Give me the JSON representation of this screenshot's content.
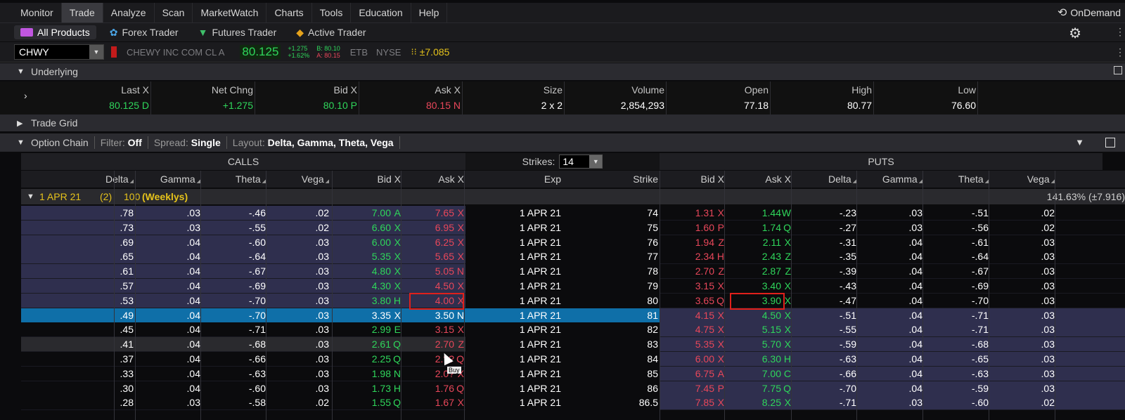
{
  "nav": {
    "tabs": [
      "Monitor",
      "Trade",
      "Analyze",
      "Scan",
      "MarketWatch",
      "Charts",
      "Tools",
      "Education",
      "Help"
    ],
    "active_tab": "Trade",
    "ondemand": "OnDemand"
  },
  "products": {
    "items": [
      "All Products",
      "Forex Trader",
      "Futures Trader",
      "Active Trader"
    ],
    "active": "All Products"
  },
  "symbol_bar": {
    "symbol": "CHWY",
    "description": "CHEWY INC COM CL A",
    "last": "80.125",
    "change_top": "+1.275",
    "change_bottom": "+1.62%",
    "bid": "B: 80.10",
    "ask": "A: 80.15",
    "etb": "ETB",
    "exchange": "NYSE",
    "expected_move": "±7.085"
  },
  "underlying": {
    "title": "Underlying",
    "headers": [
      "Last X",
      "Net Chng",
      "Bid X",
      "Ask X",
      "Size",
      "Volume",
      "Open",
      "High",
      "Low"
    ],
    "values": [
      "80.125 D",
      "+1.275",
      "80.10 P",
      "80.15 N",
      "2 x 2",
      "2,854,293",
      "77.18",
      "80.77",
      "76.60"
    ]
  },
  "trade_grid": {
    "title": "Trade Grid"
  },
  "option_chain": {
    "title": "Option Chain",
    "filter_label": "Filter:",
    "filter_value": "Off",
    "spread_label": "Spread:",
    "spread_value": "Single",
    "layout_label": "Layout:",
    "layout_value": "Delta, Gamma, Theta, Vega",
    "calls_label": "CALLS",
    "puts_label": "PUTS",
    "strikes_label": "Strikes:",
    "strikes_value": "14",
    "call_headers": [
      "Delta",
      "Gamma",
      "Theta",
      "Vega",
      "Bid X",
      "Ask X"
    ],
    "mid_headers": [
      "Exp",
      "Strike"
    ],
    "put_headers": [
      "Bid X",
      "Ask X",
      "Delta",
      "Gamma",
      "Theta",
      "Vega"
    ],
    "expiry_group": {
      "label": "1 APR 21",
      "count": "(2)",
      "mult": "100",
      "type": "(Weeklys)",
      "iv": "141.63% (±7.916)"
    },
    "rows": [
      {
        "cd": ".78",
        "cg": ".03",
        "ct": "-.46",
        "cv": ".02",
        "cb": "7.00",
        "cbx": "A",
        "ca": "7.65",
        "cax": "X",
        "exp": "1 APR 21",
        "strike": "74",
        "pb": "1.31",
        "pbx": "X",
        "pa": "1.44",
        "pax": "W",
        "pd": "-.23",
        "pg": ".03",
        "pt": "-.51",
        "pv": ".02"
      },
      {
        "cd": ".73",
        "cg": ".03",
        "ct": "-.55",
        "cv": ".02",
        "cb": "6.60",
        "cbx": "X",
        "ca": "6.95",
        "cax": "X",
        "exp": "1 APR 21",
        "strike": "75",
        "pb": "1.60",
        "pbx": "P",
        "pa": "1.74",
        "pax": "Q",
        "pd": "-.27",
        "pg": ".03",
        "pt": "-.56",
        "pv": ".02"
      },
      {
        "cd": ".69",
        "cg": ".04",
        "ct": "-.60",
        "cv": ".03",
        "cb": "6.00",
        "cbx": "X",
        "ca": "6.25",
        "cax": "X",
        "exp": "1 APR 21",
        "strike": "76",
        "pb": "1.94",
        "pbx": "Z",
        "pa": "2.11",
        "pax": "X",
        "pd": "-.31",
        "pg": ".04",
        "pt": "-.61",
        "pv": ".03"
      },
      {
        "cd": ".65",
        "cg": ".04",
        "ct": "-.64",
        "cv": ".03",
        "cb": "5.35",
        "cbx": "X",
        "ca": "5.65",
        "cax": "X",
        "exp": "1 APR 21",
        "strike": "77",
        "pb": "2.34",
        "pbx": "H",
        "pa": "2.43",
        "pax": "Z",
        "pd": "-.35",
        "pg": ".04",
        "pt": "-.64",
        "pv": ".03"
      },
      {
        "cd": ".61",
        "cg": ".04",
        "ct": "-.67",
        "cv": ".03",
        "cb": "4.80",
        "cbx": "X",
        "ca": "5.05",
        "cax": "N",
        "exp": "1 APR 21",
        "strike": "78",
        "pb": "2.70",
        "pbx": "Z",
        "pa": "2.87",
        "pax": "Z",
        "pd": "-.39",
        "pg": ".04",
        "pt": "-.67",
        "pv": ".03"
      },
      {
        "cd": ".57",
        "cg": ".04",
        "ct": "-.69",
        "cv": ".03",
        "cb": "4.30",
        "cbx": "X",
        "ca": "4.50",
        "cax": "X",
        "exp": "1 APR 21",
        "strike": "79",
        "pb": "3.15",
        "pbx": "X",
        "pa": "3.40",
        "pax": "X",
        "pd": "-.43",
        "pg": ".04",
        "pt": "-.69",
        "pv": ".03"
      },
      {
        "cd": ".53",
        "cg": ".04",
        "ct": "-.70",
        "cv": ".03",
        "cb": "3.80",
        "cbx": "H",
        "ca": "4.00",
        "cax": "X",
        "exp": "1 APR 21",
        "strike": "80",
        "pb": "3.65",
        "pbx": "Q",
        "pa": "3.90",
        "pax": "X",
        "pd": "-.47",
        "pg": ".04",
        "pt": "-.70",
        "pv": ".03"
      },
      {
        "cd": ".49",
        "cg": ".04",
        "ct": "-.70",
        "cv": ".03",
        "cb": "3.35",
        "cbx": "X",
        "ca": "3.50",
        "cax": "N",
        "exp": "1 APR 21",
        "strike": "81",
        "pb": "4.15",
        "pbx": "X",
        "pa": "4.50",
        "pax": "X",
        "pd": "-.51",
        "pg": ".04",
        "pt": "-.71",
        "pv": ".03"
      },
      {
        "cd": ".45",
        "cg": ".04",
        "ct": "-.71",
        "cv": ".03",
        "cb": "2.99",
        "cbx": "E",
        "ca": "3.15",
        "cax": "X",
        "exp": "1 APR 21",
        "strike": "82",
        "pb": "4.75",
        "pbx": "X",
        "pa": "5.15",
        "pax": "X",
        "pd": "-.55",
        "pg": ".04",
        "pt": "-.71",
        "pv": ".03"
      },
      {
        "cd": ".41",
        "cg": ".04",
        "ct": "-.68",
        "cv": ".03",
        "cb": "2.61",
        "cbx": "Q",
        "ca": "2.70",
        "cax": "Z",
        "exp": "1 APR 21",
        "strike": "83",
        "pb": "5.35",
        "pbx": "X",
        "pa": "5.70",
        "pax": "X",
        "pd": "-.59",
        "pg": ".04",
        "pt": "-.68",
        "pv": ".03"
      },
      {
        "cd": ".37",
        "cg": ".04",
        "ct": "-.66",
        "cv": ".03",
        "cb": "2.25",
        "cbx": "Q",
        "ca": "2.??",
        "cax": "Q",
        "exp": "1 APR 21",
        "strike": "84",
        "pb": "6.00",
        "pbx": "X",
        "pa": "6.30",
        "pax": "H",
        "pd": "-.63",
        "pg": ".04",
        "pt": "-.65",
        "pv": ".03"
      },
      {
        "cd": ".33",
        "cg": ".04",
        "ct": "-.63",
        "cv": ".03",
        "cb": "1.98",
        "cbx": "N",
        "ca": "2.0?",
        "cax": "X",
        "exp": "1 APR 21",
        "strike": "85",
        "pb": "6.75",
        "pbx": "A",
        "pa": "7.00",
        "pax": "C",
        "pd": "-.66",
        "pg": ".04",
        "pt": "-.63",
        "pv": ".03"
      },
      {
        "cd": ".30",
        "cg": ".04",
        "ct": "-.60",
        "cv": ".03",
        "cb": "1.73",
        "cbx": "H",
        "ca": "1.76",
        "cax": "Q",
        "exp": "1 APR 21",
        "strike": "86",
        "pb": "7.45",
        "pbx": "P",
        "pa": "7.75",
        "pax": "Q",
        "pd": "-.70",
        "pg": ".04",
        "pt": "-.59",
        "pv": ".03"
      },
      {
        "cd": ".28",
        "cg": ".03",
        "ct": "-.58",
        "cv": ".02",
        "cb": "1.55",
        "cbx": "Q",
        "ca": "1.67",
        "cax": "X",
        "exp": "1 APR 21",
        "strike": "86.5",
        "pb": "7.85",
        "pbx": "X",
        "pa": "8.25",
        "pax": "X",
        "pd": "-.71",
        "pg": ".03",
        "pt": "-.60",
        "pv": ".02"
      }
    ]
  },
  "cursor_tooltip": "Buy",
  "colors": {
    "bid_green": "#2fd65b",
    "ask_red": "#e8475a",
    "itm_bg": "#2f2f4e",
    "selected_bg": "#0f6fa8",
    "highlight_box": "#e0201b",
    "weeklys": "#e5c21b"
  }
}
